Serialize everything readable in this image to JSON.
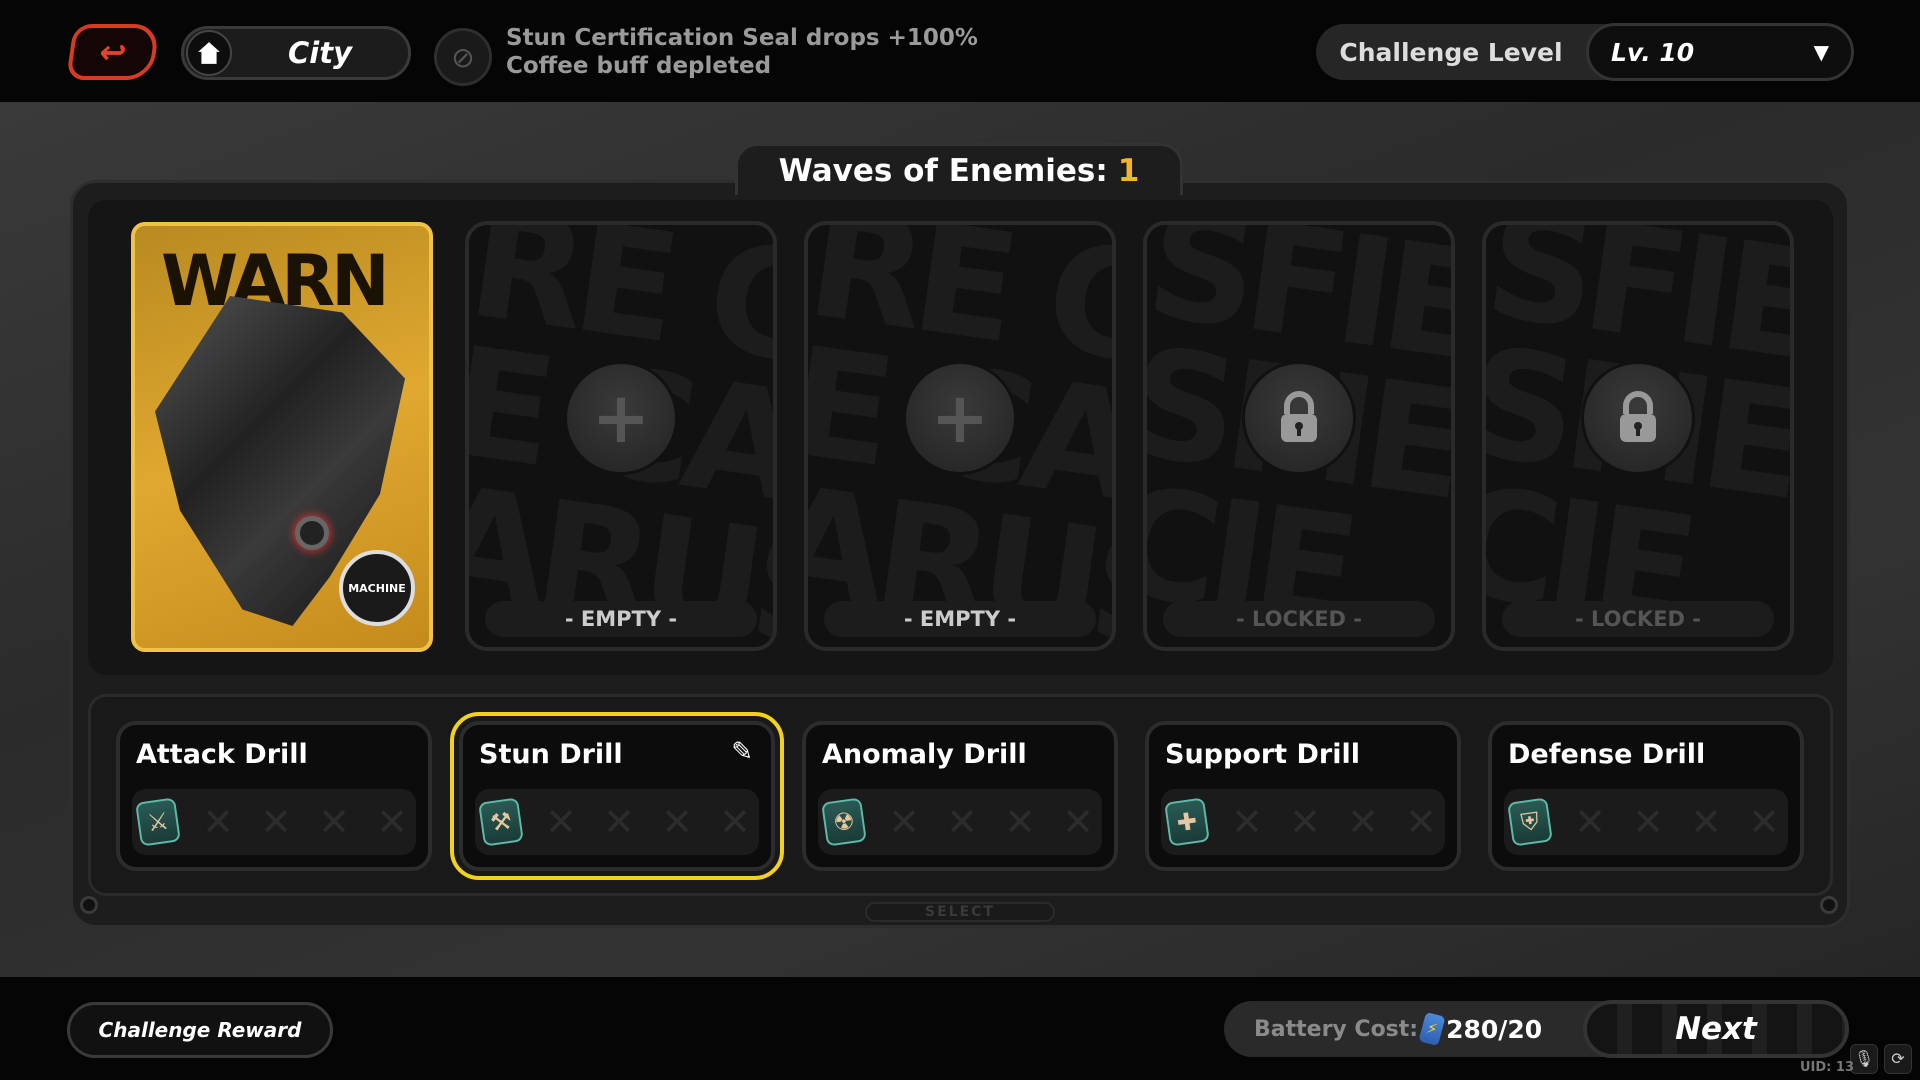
{
  "header": {
    "back_icon": "back-arrow-icon",
    "location": "City",
    "home_icon": "home-icon",
    "buff_icon": "coffee-disabled-icon",
    "buff_lines": [
      "Stun Certification Seal drops +100%",
      "Coffee buff depleted"
    ],
    "challenge_label": "Challenge Level",
    "level": "Lv. 10"
  },
  "main": {
    "title": "Waves of Enemies:",
    "waves": "1",
    "enemy": {
      "art_text": "WARN",
      "badge": "MACHINE"
    },
    "slots": [
      {
        "state": "- EMPTY -",
        "icon": "+",
        "pattern": "RE CA\nE CA\nARUS"
      },
      {
        "state": "- EMPTY -",
        "icon": "+",
        "pattern": "RE CA\nE CA\nARUS"
      },
      {
        "state": "- LOCKED -",
        "icon": "lock",
        "pattern": "SFIE\nSFIE\nCIE"
      },
      {
        "state": "- LOCKED -",
        "icon": "lock",
        "pattern": "SFIE\nSFIE\nCIE"
      }
    ],
    "drills": [
      {
        "name": "Attack Drill",
        "icon": "⚔",
        "selected": false
      },
      {
        "name": "Stun Drill",
        "icon": "⚒",
        "selected": true
      },
      {
        "name": "Anomaly Drill",
        "icon": "☢",
        "selected": false
      },
      {
        "name": "Support Drill",
        "icon": "✚",
        "selected": false
      },
      {
        "name": "Defense Drill",
        "icon": "⛨",
        "selected": false
      }
    ],
    "select_label": "SELECT"
  },
  "footer": {
    "reward": "Challenge Reward",
    "battery_label": "Battery Cost:",
    "battery_value": "280/20",
    "next": "Next",
    "uid": "UID: 13"
  },
  "colors": {
    "accent": "#f4d21c",
    "waves": "#f5b52a",
    "back": "#d83a22"
  }
}
